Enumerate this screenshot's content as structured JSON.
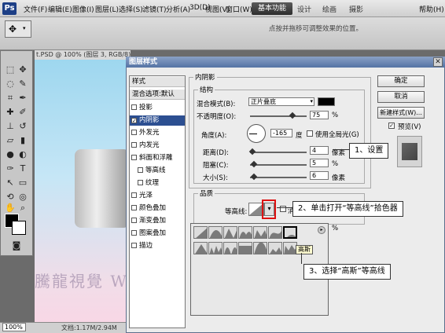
{
  "menubar": {
    "logo": "Ps",
    "items": [
      "文件(F)",
      "编辑(E)",
      "图像(I)",
      "图层(L)",
      "选择(S)",
      "滤镜(T)",
      "分析(A)",
      "3D(D)",
      "视图(V)",
      "窗口(W)",
      "帮助(H)"
    ],
    "workspace": "基本功能",
    "workspace_tabs": [
      "设计",
      "绘画",
      "摄影"
    ]
  },
  "options_bar": {
    "hint": "点按并拖移可调整效果的位置。"
  },
  "document": {
    "tab": "t.PSD @ 100% (图层 3, RGB/8)",
    "zoom": "100%",
    "info": "文档:1.17M/2.94M",
    "watermark": "騰龍視覺 WWW.TLVI.NET"
  },
  "dialog": {
    "title": "图层样式",
    "close": "✕",
    "styles_header": "样式",
    "blend_options": "混合选项:默认",
    "style_items": [
      {
        "label": "投影",
        "checked": false
      },
      {
        "label": "内阴影",
        "checked": true
      },
      {
        "label": "外发光",
        "checked": false
      },
      {
        "label": "内发光",
        "checked": false
      },
      {
        "label": "斜面和浮雕",
        "checked": false
      },
      {
        "label": "等高线",
        "checked": false
      },
      {
        "label": "纹理",
        "checked": false
      },
      {
        "label": "光泽",
        "checked": false
      },
      {
        "label": "颜色叠加",
        "checked": false
      },
      {
        "label": "渐变叠加",
        "checked": false
      },
      {
        "label": "图案叠加",
        "checked": false
      },
      {
        "label": "描边",
        "checked": false
      }
    ],
    "inner_shadow_title": "内阴影",
    "structure_title": "结构",
    "blend_mode_label": "混合模式(B):",
    "blend_mode_value": "正片叠底",
    "opacity_label": "不透明度(O):",
    "opacity_value": "75",
    "angle_label": "角度(A):",
    "angle_value": "-165",
    "angle_unit": "度",
    "global_light_label": "使用全局光(G)",
    "distance_label": "距离(D):",
    "distance_value": "4",
    "choke_label": "阻塞(C):",
    "choke_value": "5",
    "size_label": "大小(S):",
    "size_value": "6",
    "px_unit": "像素",
    "pct_unit": "%",
    "quality_title": "品质",
    "contour_label": "等高线:",
    "antialias_partial": "消",
    "pct_partial": "%",
    "buttons": {
      "ok": "确定",
      "cancel": "取消",
      "new_style": "新建样式(W)...",
      "preview": "预览(V)"
    },
    "shadow_color": "#000000",
    "selected_color": "#2c4f91"
  },
  "contour_picker": {
    "tooltip": "高斯"
  },
  "callouts": {
    "step1": "1、设置",
    "step2": "2、单击打开“等高线”拾色器",
    "step3": "3、选择“高斯”等高线"
  }
}
